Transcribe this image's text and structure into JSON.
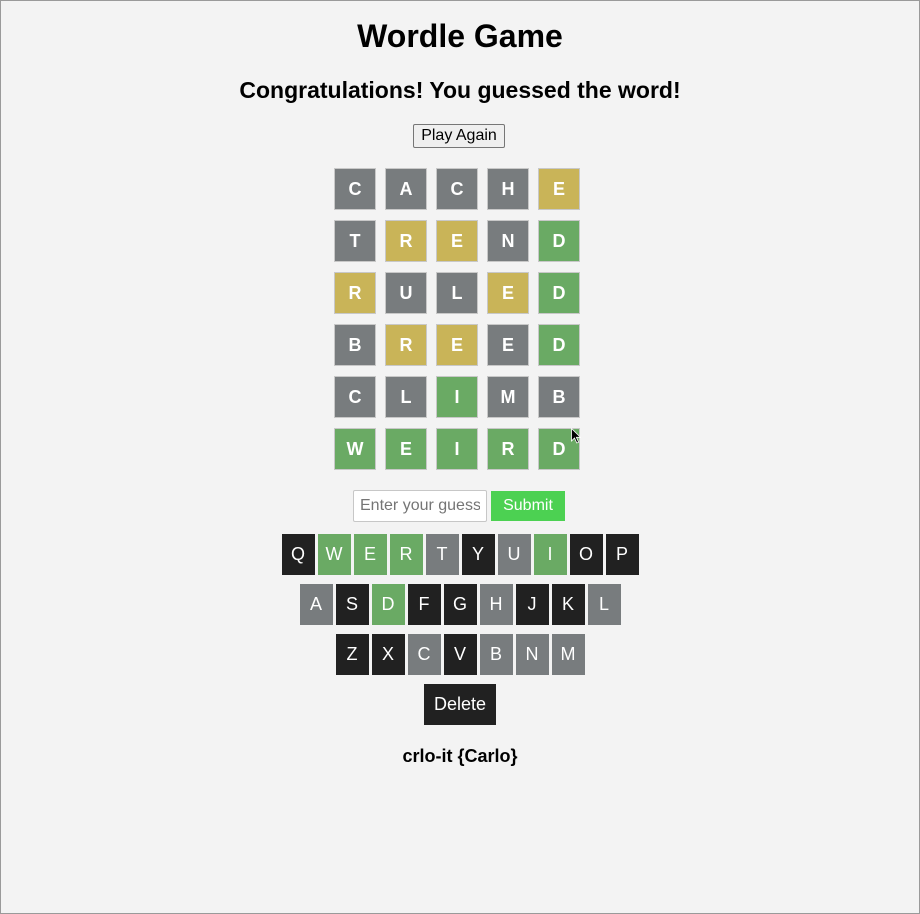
{
  "title": "Wordle Game",
  "message": "Congratulations! You guessed the word!",
  "play_again_label": "Play Again",
  "board": [
    [
      {
        "letter": "C",
        "state": "absent"
      },
      {
        "letter": "A",
        "state": "absent"
      },
      {
        "letter": "C",
        "state": "absent"
      },
      {
        "letter": "H",
        "state": "absent"
      },
      {
        "letter": "E",
        "state": "present"
      }
    ],
    [
      {
        "letter": "T",
        "state": "absent"
      },
      {
        "letter": "R",
        "state": "present"
      },
      {
        "letter": "E",
        "state": "present"
      },
      {
        "letter": "N",
        "state": "absent"
      },
      {
        "letter": "D",
        "state": "correct"
      }
    ],
    [
      {
        "letter": "R",
        "state": "present"
      },
      {
        "letter": "U",
        "state": "absent"
      },
      {
        "letter": "L",
        "state": "absent"
      },
      {
        "letter": "E",
        "state": "present"
      },
      {
        "letter": "D",
        "state": "correct"
      }
    ],
    [
      {
        "letter": "B",
        "state": "absent"
      },
      {
        "letter": "R",
        "state": "present"
      },
      {
        "letter": "E",
        "state": "present"
      },
      {
        "letter": "E",
        "state": "absent"
      },
      {
        "letter": "D",
        "state": "correct"
      }
    ],
    [
      {
        "letter": "C",
        "state": "absent"
      },
      {
        "letter": "L",
        "state": "absent"
      },
      {
        "letter": "I",
        "state": "correct"
      },
      {
        "letter": "M",
        "state": "absent"
      },
      {
        "letter": "B",
        "state": "absent"
      }
    ],
    [
      {
        "letter": "W",
        "state": "correct"
      },
      {
        "letter": "E",
        "state": "correct"
      },
      {
        "letter": "I",
        "state": "correct"
      },
      {
        "letter": "R",
        "state": "correct"
      },
      {
        "letter": "D",
        "state": "correct"
      }
    ]
  ],
  "guess_input": {
    "value": "",
    "placeholder": "Enter your guess"
  },
  "submit_label": "Submit",
  "keyboard": [
    [
      {
        "key": "Q",
        "state": "unused"
      },
      {
        "key": "W",
        "state": "correct"
      },
      {
        "key": "E",
        "state": "correct"
      },
      {
        "key": "R",
        "state": "correct"
      },
      {
        "key": "T",
        "state": "absent"
      },
      {
        "key": "Y",
        "state": "unused"
      },
      {
        "key": "U",
        "state": "absent"
      },
      {
        "key": "I",
        "state": "correct"
      },
      {
        "key": "O",
        "state": "unused"
      },
      {
        "key": "P",
        "state": "unused"
      }
    ],
    [
      {
        "key": "A",
        "state": "absent"
      },
      {
        "key": "S",
        "state": "unused"
      },
      {
        "key": "D",
        "state": "correct"
      },
      {
        "key": "F",
        "state": "unused"
      },
      {
        "key": "G",
        "state": "unused"
      },
      {
        "key": "H",
        "state": "absent"
      },
      {
        "key": "J",
        "state": "unused"
      },
      {
        "key": "K",
        "state": "unused"
      },
      {
        "key": "L",
        "state": "absent"
      }
    ],
    [
      {
        "key": "Z",
        "state": "unused"
      },
      {
        "key": "X",
        "state": "unused"
      },
      {
        "key": "C",
        "state": "absent"
      },
      {
        "key": "V",
        "state": "unused"
      },
      {
        "key": "B",
        "state": "absent"
      },
      {
        "key": "N",
        "state": "absent"
      },
      {
        "key": "M",
        "state": "absent"
      }
    ]
  ],
  "delete_label": "Delete",
  "footer_text": "crlo-it {Carlo}",
  "colors": {
    "absent": "#787c7e",
    "present": "#c9b458",
    "correct": "#6aaa64",
    "unused_key": "#212121",
    "submit": "#4cd152",
    "background": "#f3f3f3"
  },
  "icons": {
    "cursor": "mouse-pointer-icon"
  }
}
